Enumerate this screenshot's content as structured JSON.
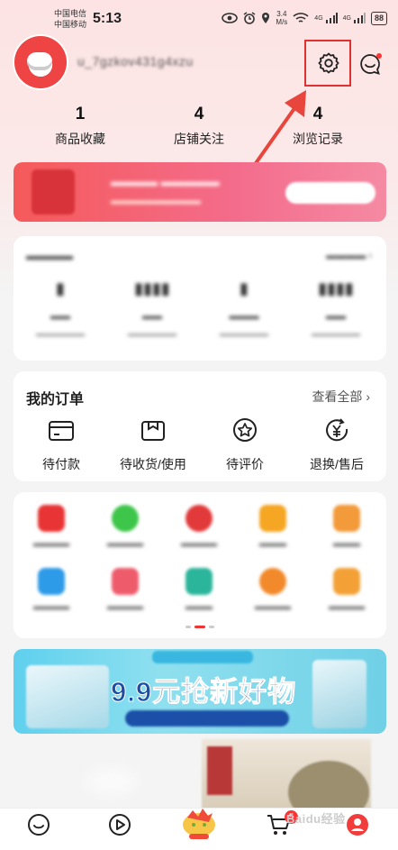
{
  "status_bar": {
    "carrier_1": "中国电信",
    "carrier_2": "中国移动",
    "time": "5:13",
    "speed_value": "3.4",
    "speed_unit": "M/s",
    "net_1": "4G",
    "net_2": "4G",
    "battery": "88"
  },
  "profile": {
    "username": "u_7gzkov431g4xzu"
  },
  "stats": [
    {
      "count": "1",
      "label": "商品收藏"
    },
    {
      "count": "4",
      "label": "店铺关注"
    },
    {
      "count": "4",
      "label": "浏览记录"
    }
  ],
  "orders": {
    "title": "我的订单",
    "view_all": "查看全部",
    "items": [
      {
        "label": "待付款",
        "icon": "wallet-icon"
      },
      {
        "label": "待收货/使用",
        "icon": "package-icon"
      },
      {
        "label": "待评价",
        "icon": "star-badge-icon"
      },
      {
        "label": "退换/售后",
        "icon": "yuan-return-icon"
      }
    ]
  },
  "ad_banner": {
    "headline": "9.9元抢新好物"
  },
  "watermark": "Baidu经验",
  "tabbar": {
    "cart_badge": "5"
  },
  "colors": {
    "accent_red": "#e03030",
    "header_pink": "#fde3e3",
    "ad_blue": "#1b4fa8"
  }
}
